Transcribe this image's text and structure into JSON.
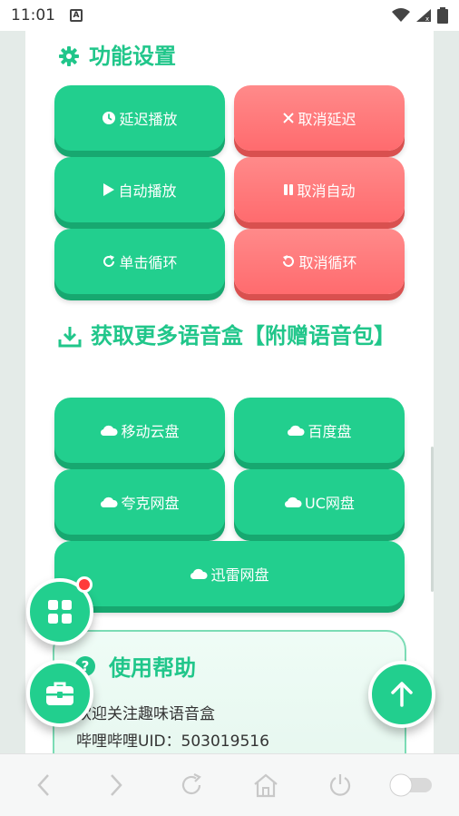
{
  "status_bar": {
    "time": "11:01",
    "notification_icon": "A"
  },
  "section_function": {
    "title": "功能设置",
    "buttons": {
      "delay_play": "延迟播放",
      "cancel_delay": "取消延迟",
      "auto_play": "自动播放",
      "cancel_auto": "取消自动",
      "single_loop": "单击循环",
      "cancel_loop": "取消循环"
    }
  },
  "section_download": {
    "title": "获取更多语音盒【附赠语音包】",
    "buttons": {
      "mobile_cloud": "移动云盘",
      "baidu_pan": "百度盘",
      "quark_pan": "夸克网盘",
      "uc_pan": "UC网盘",
      "xunlei_pan": "迅雷网盘"
    }
  },
  "help": {
    "title": "使用帮助",
    "line1": "欢迎关注趣味语音盒",
    "line2": "哔哩哔哩UID：503019516"
  },
  "colors": {
    "accent": "#22cf8e",
    "danger": "#ff6b6e",
    "title": "#20c68a"
  }
}
